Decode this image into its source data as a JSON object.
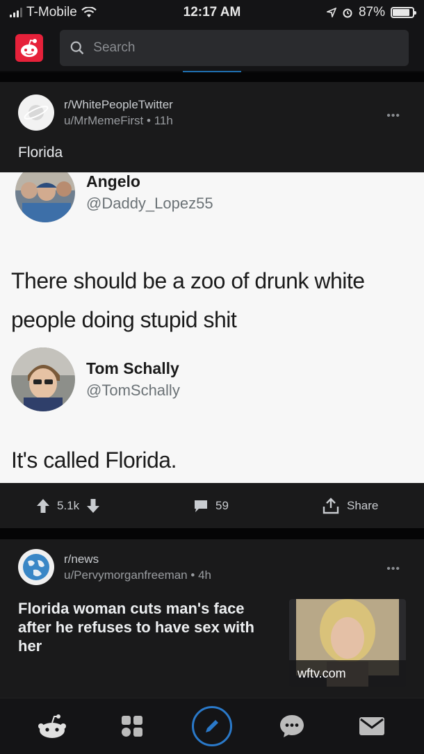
{
  "status_bar": {
    "carrier": "T-Mobile",
    "time": "12:17 AM",
    "battery": "87%",
    "battery_level": 0.87
  },
  "header": {
    "search_placeholder": "Search",
    "logo_icon": "reddit-snoo-icon"
  },
  "post1": {
    "subreddit": "r/WhitePeopleTwitter",
    "user": "u/MrMemeFirst",
    "age": "11h",
    "title": "Florida",
    "tweet": {
      "user1_name": "Angelo",
      "user1_handle": "@Daddy_Lopez55",
      "user1_line1": "There should be a zoo of drunk white",
      "user1_line2": "people doing stupid shit",
      "user2_name": "Tom Schally",
      "user2_handle": "@TomSchally",
      "user2_text": "It's called Florida."
    },
    "votes": "5.1k",
    "comments": "59",
    "share_label": "Share"
  },
  "post2": {
    "subreddit": "r/news",
    "user": "u/Pervymorganfreeman",
    "age": "4h",
    "title": "Florida woman cuts man's face after he refuses to have sex with her",
    "thumb_domain": "wftv.com"
  },
  "colors": {
    "accent": "#2a79c9",
    "brand": "#e6213a",
    "background": "#1a1a1b"
  }
}
